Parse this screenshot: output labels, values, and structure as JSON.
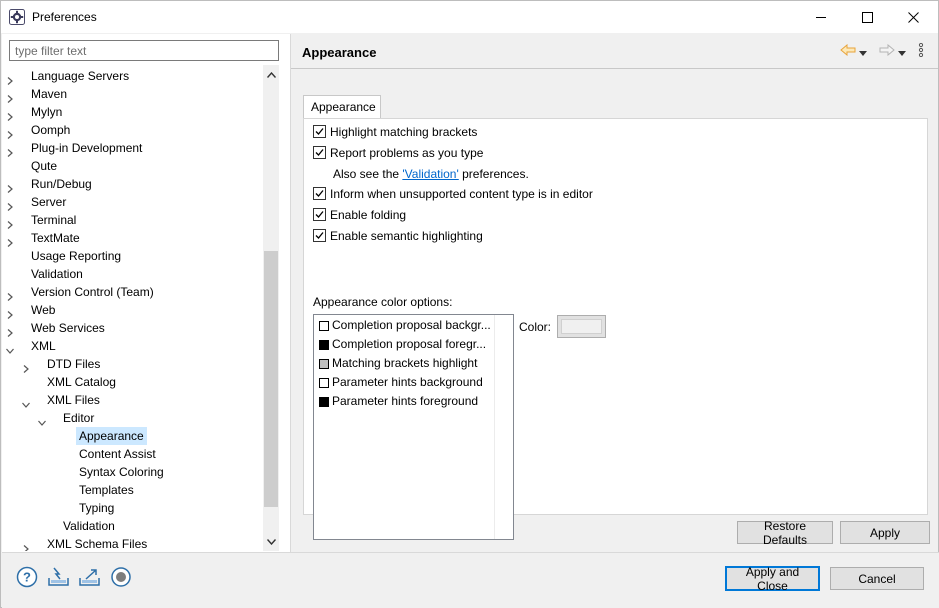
{
  "window": {
    "title": "Preferences",
    "icon": "eclipse-gear-icon"
  },
  "filter": {
    "placeholder": "type filter text"
  },
  "tree": {
    "items": [
      {
        "label": "Language Servers",
        "depth": 0,
        "expander": "collapsed"
      },
      {
        "label": "Maven",
        "depth": 0,
        "expander": "collapsed"
      },
      {
        "label": "Mylyn",
        "depth": 0,
        "expander": "collapsed"
      },
      {
        "label": "Oomph",
        "depth": 0,
        "expander": "collapsed"
      },
      {
        "label": "Plug-in Development",
        "depth": 0,
        "expander": "collapsed"
      },
      {
        "label": "Qute",
        "depth": 0,
        "expander": "none"
      },
      {
        "label": "Run/Debug",
        "depth": 0,
        "expander": "collapsed"
      },
      {
        "label": "Server",
        "depth": 0,
        "expander": "collapsed"
      },
      {
        "label": "Terminal",
        "depth": 0,
        "expander": "collapsed"
      },
      {
        "label": "TextMate",
        "depth": 0,
        "expander": "collapsed"
      },
      {
        "label": "Usage Reporting",
        "depth": 0,
        "expander": "none"
      },
      {
        "label": "Validation",
        "depth": 0,
        "expander": "none"
      },
      {
        "label": "Version Control (Team)",
        "depth": 0,
        "expander": "collapsed"
      },
      {
        "label": "Web",
        "depth": 0,
        "expander": "collapsed"
      },
      {
        "label": "Web Services",
        "depth": 0,
        "expander": "collapsed"
      },
      {
        "label": "XML",
        "depth": 0,
        "expander": "expanded"
      },
      {
        "label": "DTD Files",
        "depth": 1,
        "expander": "collapsed"
      },
      {
        "label": "XML Catalog",
        "depth": 1,
        "expander": "none"
      },
      {
        "label": "XML Files",
        "depth": 1,
        "expander": "expanded"
      },
      {
        "label": "Editor",
        "depth": 2,
        "expander": "expanded"
      },
      {
        "label": "Appearance",
        "depth": 3,
        "expander": "none",
        "selected": true
      },
      {
        "label": "Content Assist",
        "depth": 3,
        "expander": "none"
      },
      {
        "label": "Syntax Coloring",
        "depth": 3,
        "expander": "none"
      },
      {
        "label": "Templates",
        "depth": 3,
        "expander": "none"
      },
      {
        "label": "Typing",
        "depth": 3,
        "expander": "none"
      },
      {
        "label": "Validation",
        "depth": 2,
        "expander": "none"
      },
      {
        "label": "XML Schema Files",
        "depth": 1,
        "expander": "collapsed"
      }
    ]
  },
  "page": {
    "title": "Appearance",
    "tab_label": "Appearance",
    "checkboxes": [
      {
        "label": "Highlight matching brackets",
        "checked": true
      },
      {
        "label": "Report problems as you type",
        "checked": true
      },
      {
        "label": "Inform when unsupported content type is in editor",
        "checked": true
      },
      {
        "label": "Enable folding",
        "checked": true
      },
      {
        "label": "Enable semantic highlighting",
        "checked": true
      }
    ],
    "see_also": {
      "prefix": "Also see the ",
      "link": "'Validation'",
      "suffix": " preferences."
    },
    "color_options_label": "Appearance color options:",
    "color_items": [
      {
        "label": "Completion proposal backgr...",
        "swatch": "#ffffff"
      },
      {
        "label": "Completion proposal foregr...",
        "swatch": "#000000"
      },
      {
        "label": "Matching brackets highlight",
        "swatch": "#c0c0c0"
      },
      {
        "label": "Parameter hints background",
        "swatch": "#ffffff"
      },
      {
        "label": "Parameter hints foreground",
        "swatch": "#000000"
      }
    ],
    "color_label": "Color:",
    "color_value": "#f0f0f0"
  },
  "buttons": {
    "restore_defaults": "Restore Defaults",
    "apply": "Apply",
    "apply_and_close": "Apply and Close",
    "cancel": "Cancel"
  },
  "bottom_icons": [
    "help-icon",
    "import-icon",
    "export-icon",
    "record-icon"
  ],
  "colors": {
    "accent": "#0078d7",
    "selection": "#cce8ff",
    "link": "#0066cc",
    "back_arrow": "#e8a33a"
  }
}
